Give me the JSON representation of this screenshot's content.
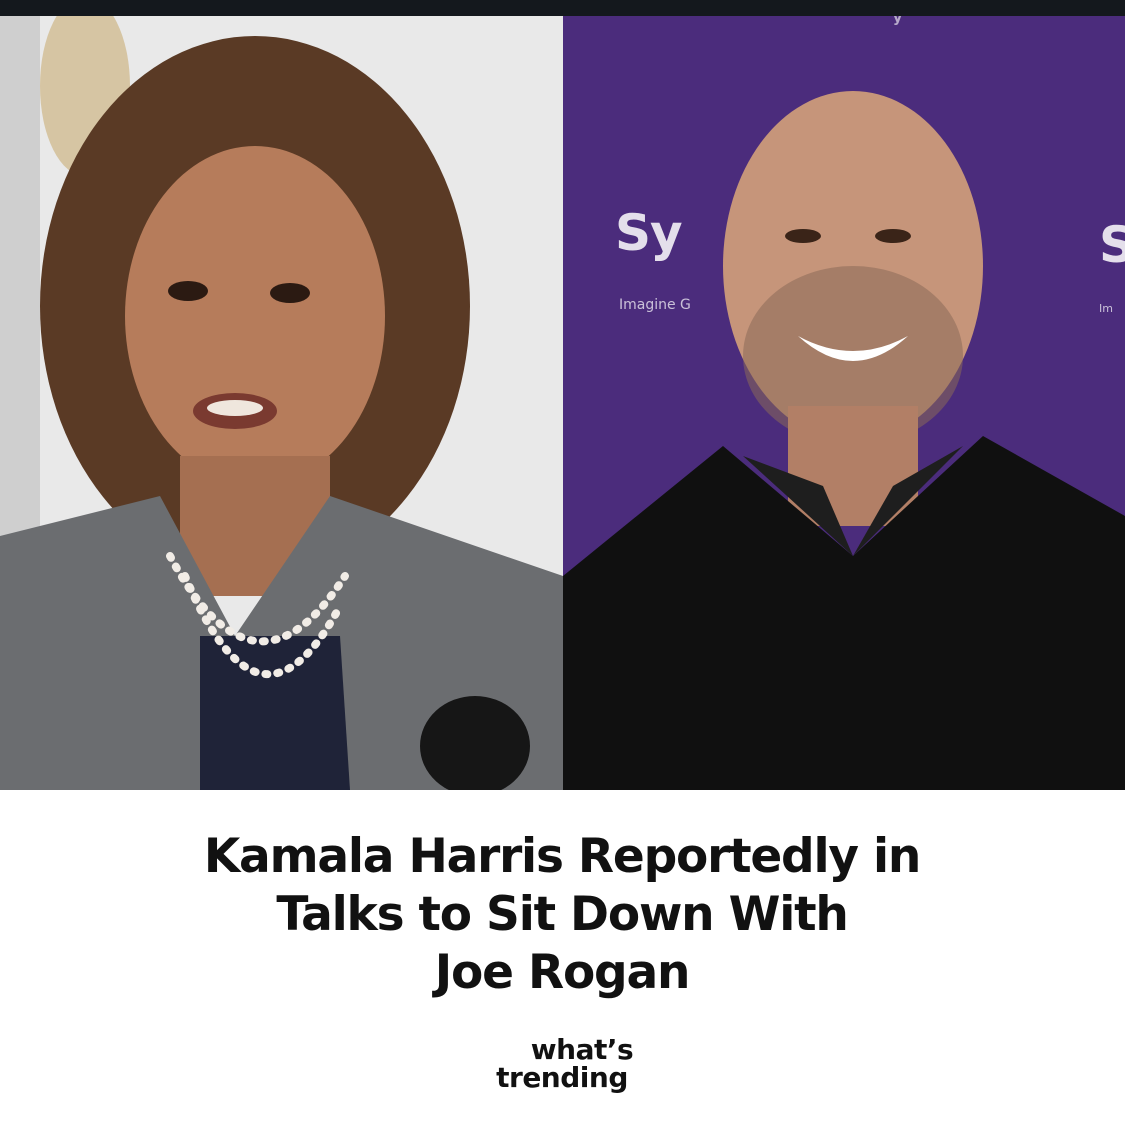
{
  "backdrop": {
    "logo_fragment_left": "Sy",
    "tagline_fragment_left": "Imagine G",
    "logo_fragment_right": "S",
    "tagline_fragment_right": "Im",
    "top_fragment": "y"
  },
  "headline": {
    "line1": "Kamala Harris Reportedly in",
    "line2": "Talks to Sit Down With",
    "line3": "Joe Rogan"
  },
  "brand": {
    "line1": "what’s",
    "line2": "trending"
  },
  "colors": {
    "top_strip": "#14181d",
    "backdrop_purple": "#4a2a7a",
    "text": "#111111",
    "background": "#ffffff"
  }
}
